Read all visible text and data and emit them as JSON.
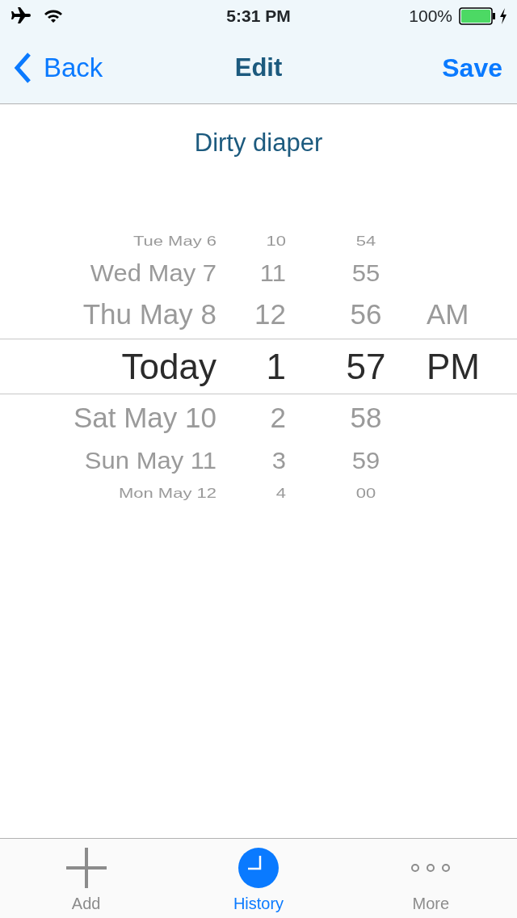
{
  "status_bar": {
    "time": "5:31 PM",
    "battery": "100%",
    "airplane_mode": true,
    "charging": true
  },
  "nav": {
    "back": "Back",
    "title": "Edit",
    "action": "Save"
  },
  "event_title": "Dirty diaper",
  "picker_rows": [
    {
      "date": "Tue May 6",
      "hour": "10",
      "minute": "54",
      "selected": false
    },
    {
      "date": "Wed May 7",
      "hour": "11",
      "minute": "55",
      "selected": false
    },
    {
      "date": "Thu May 8",
      "hour": "12",
      "minute": "56",
      "period": "AM",
      "selected": false
    },
    {
      "date": "Today",
      "hour": "1",
      "minute": "57",
      "period": "PM",
      "selected": true
    },
    {
      "date": "Sat May 10",
      "hour": "2",
      "minute": "58",
      "selected": false
    },
    {
      "date": "Sun May 11",
      "hour": "3",
      "minute": "59",
      "selected": false
    },
    {
      "date": "Mon May 12",
      "hour": "4",
      "minute": "00",
      "selected": false
    }
  ],
  "tabs": [
    {
      "label": "Add",
      "kind": "add",
      "selected": false
    },
    {
      "label": "History",
      "kind": "history",
      "selected": true
    },
    {
      "label": "More",
      "kind": "more",
      "selected": false
    }
  ]
}
